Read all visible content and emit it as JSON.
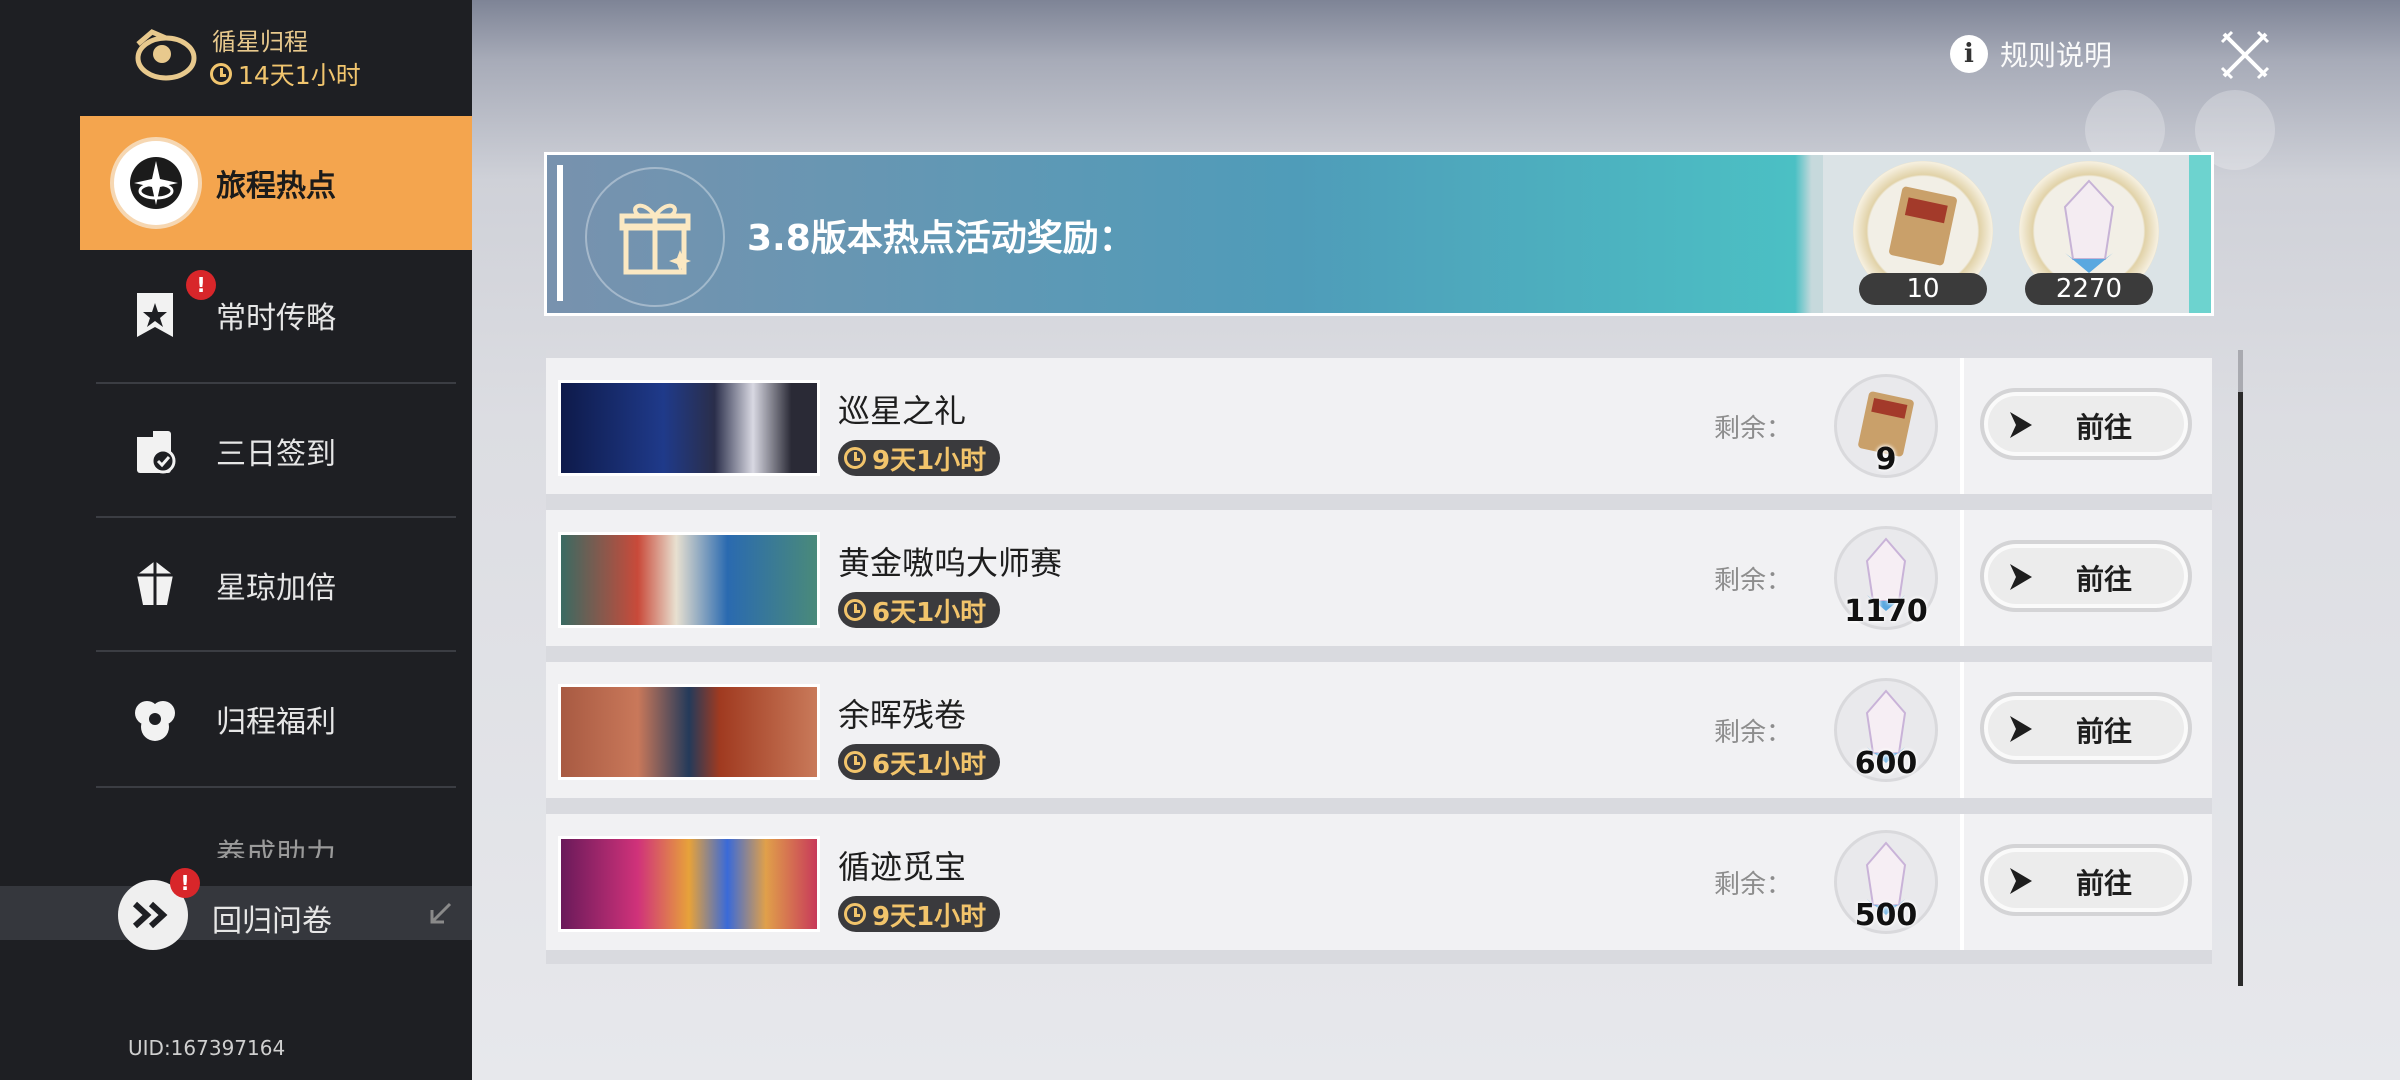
{
  "event": {
    "title": "循星归程",
    "timer": "14天1小时"
  },
  "sidebar": {
    "items": [
      {
        "label": "旅程热点",
        "icon": "compass-icon",
        "active": true
      },
      {
        "label": "常时传略",
        "icon": "star-bookmark-icon",
        "badge": "!"
      },
      {
        "label": "三日签到",
        "icon": "checkin-icon"
      },
      {
        "label": "星琼加倍",
        "icon": "crystal-icon"
      },
      {
        "label": "归程福利",
        "icon": "gift-flower-icon"
      },
      {
        "label": "养成助力",
        "icon": "boost-icon"
      }
    ],
    "survey": {
      "label": "回归问卷",
      "badge": "!"
    },
    "uid": "UID:167397164"
  },
  "header": {
    "rules_label": "规则说明",
    "info_glyph": "i"
  },
  "banner": {
    "title": "3.8版本热点活动奖励：",
    "rewards": [
      {
        "icon": "pass-ticket-icon",
        "count": "10"
      },
      {
        "icon": "stellar-jade-icon",
        "count": "2270"
      }
    ]
  },
  "activities": [
    {
      "title": "巡星之礼",
      "timer": "9天1小时",
      "remain_label": "剩余：",
      "reward_icon": "pass-ticket-icon",
      "reward_count": "9",
      "button": "前往"
    },
    {
      "title": "黄金嗷呜大师赛",
      "timer": "6天1小时",
      "remain_label": "剩余：",
      "reward_icon": "stellar-jade-icon",
      "reward_count": "1170",
      "button": "前往"
    },
    {
      "title": "余晖残卷",
      "timer": "6天1小时",
      "remain_label": "剩余：",
      "reward_icon": "stellar-jade-icon",
      "reward_count": "600",
      "button": "前往"
    },
    {
      "title": "循迹觅宝",
      "timer": "9天1小时",
      "remain_label": "剩余：",
      "reward_icon": "stellar-jade-icon",
      "reward_count": "500",
      "button": "前往"
    }
  ],
  "colors": {
    "accent": "#f4a54e",
    "sidebar_bg": "#1e1f23",
    "timer_text": "#f2c46b",
    "badge": "#d8262a"
  }
}
